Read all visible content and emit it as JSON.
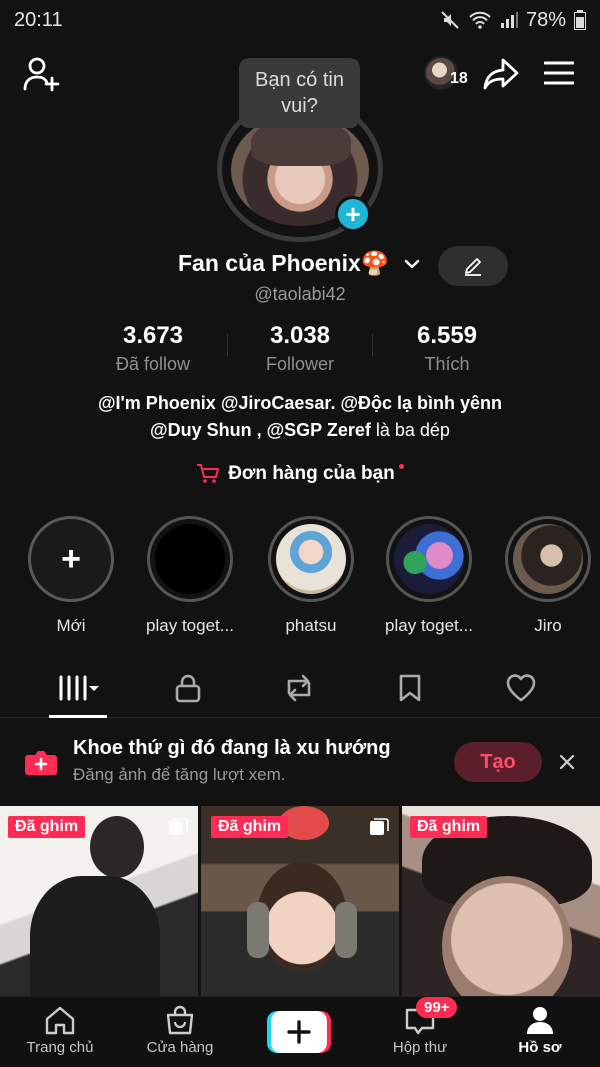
{
  "status_bar": {
    "time": "20:11",
    "battery": "78%"
  },
  "header": {
    "friends_count": "18"
  },
  "profile": {
    "tooltip": "Bạn có tin vui?",
    "display_name": "Fan của Phoenix🍄",
    "username": "@taolabi42",
    "bio_bold_1": "@I'm Phoenix @JiroCaesar. @Độc lạ bình yênn",
    "bio_bold_2": "@Duy Shun , @SGP Zeref",
    "bio_plain": " là ba dép",
    "orders_label": "Đơn hàng của bạn"
  },
  "stats": [
    {
      "value": "3.673",
      "label": "Đã follow"
    },
    {
      "value": "3.038",
      "label": "Follower"
    },
    {
      "value": "6.559",
      "label": "Thích"
    }
  ],
  "highlights": [
    {
      "label": "Mới",
      "plus": "+"
    },
    {
      "label": "play toget..."
    },
    {
      "label": "phatsu"
    },
    {
      "label": "play toget..."
    },
    {
      "label": "Jiro"
    }
  ],
  "banner": {
    "title": "Khoe thứ gì đó đang là xu hướng",
    "subtitle": "Đăng ảnh để tăng lượt xem.",
    "create_label": "Tạo"
  },
  "videos": [
    {
      "badge": "Đã ghim"
    },
    {
      "badge": "Đã ghim"
    },
    {
      "badge": "Đã ghim"
    }
  ],
  "bottom_nav": {
    "home": "Trang chủ",
    "shop": "Cửa hàng",
    "inbox": "Hộp thư",
    "inbox_badge": "99+",
    "profile": "Hồ sơ"
  },
  "colors": {
    "accent": "#fe2c55",
    "cyan": "#20b6d8",
    "background": "#121212"
  }
}
